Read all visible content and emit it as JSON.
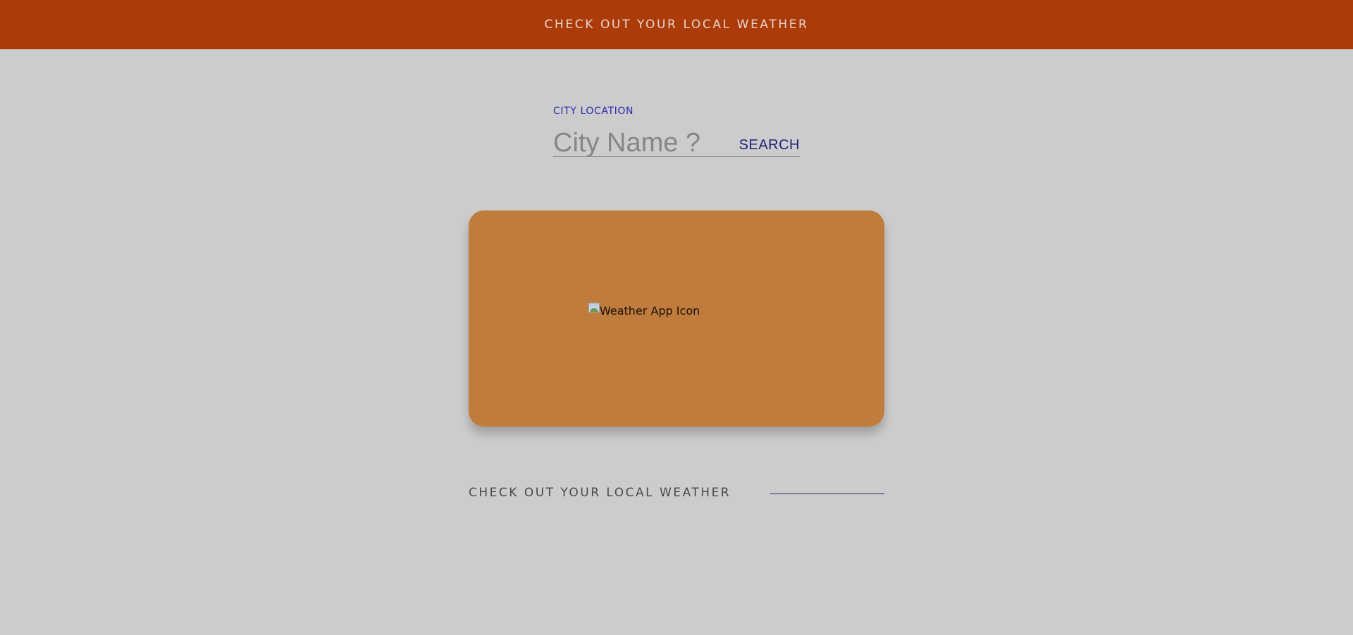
{
  "header": {
    "title": "CHECK OUT YOUR LOCAL WEATHER"
  },
  "search": {
    "label": "CITY LOCATION",
    "placeholder": "City Name ?",
    "value": "",
    "button_label": "SEARCH"
  },
  "card": {
    "image_alt": "Weather App Icon"
  },
  "footer": {
    "text": "CHECK OUT YOUR LOCAL WEATHER"
  },
  "colors": {
    "header_bg": "#ab3c09",
    "page_bg": "#cccccc",
    "card_bg": "#c07c3d",
    "label_color": "#2a2ab3",
    "button_color": "#1d2378"
  }
}
